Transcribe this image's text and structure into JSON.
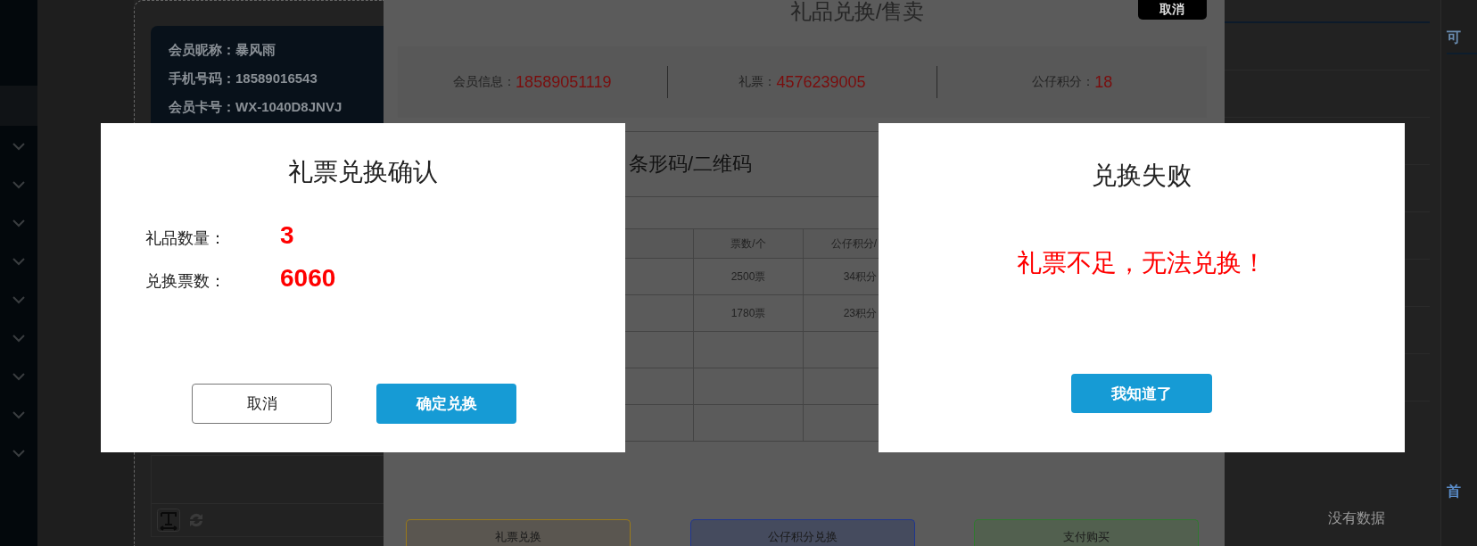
{
  "member_card": {
    "lines": [
      {
        "label": "会员昵称：",
        "value": "暴风雨"
      },
      {
        "label": "手机号码：",
        "value": "18589016543"
      },
      {
        "label": "会员卡号：",
        "value": "WX-1040D8JNVJ"
      }
    ]
  },
  "right_panel": {
    "tab": "可",
    "empty_text": "没有数据",
    "pager": "首"
  },
  "exchange_modal": {
    "title": "礼品兑换/售卖",
    "cancel_button": "取消",
    "info": [
      {
        "label": "会员信息：",
        "value": "18589051119"
      },
      {
        "label": "礼票：",
        "value": "4576239005"
      },
      {
        "label": "公仔积分：",
        "value": "18"
      }
    ],
    "scan_field": {
      "placeholder": "条形码/二维码"
    },
    "table": {
      "columns": [
        "票数/个",
        "公仔积分/"
      ],
      "rows": [
        {
          "tickets": "2500票",
          "points": "34积分"
        },
        {
          "tickets": "1780票",
          "points": "23积分"
        }
      ]
    },
    "actions": [
      {
        "label": "礼票兑换",
        "color": "#9a7a1a"
      },
      {
        "label": "公仔积分兑换",
        "color": "#1f3590"
      },
      {
        "label": "支付购买",
        "color": "#2f7a2f"
      }
    ]
  },
  "confirm_dialog": {
    "title": "礼票兑换确认",
    "fields": [
      {
        "label": "礼品数量：",
        "value": "3"
      },
      {
        "label": "兑换票数：",
        "value": "6060"
      }
    ],
    "buttons": [
      {
        "label": "取消",
        "kind": "secondary"
      },
      {
        "label": "确定兑换",
        "kind": "primary"
      }
    ]
  },
  "fail_dialog": {
    "title": "兑换失败",
    "message": "礼票不足，无法兑换！",
    "button": "我知道了"
  }
}
